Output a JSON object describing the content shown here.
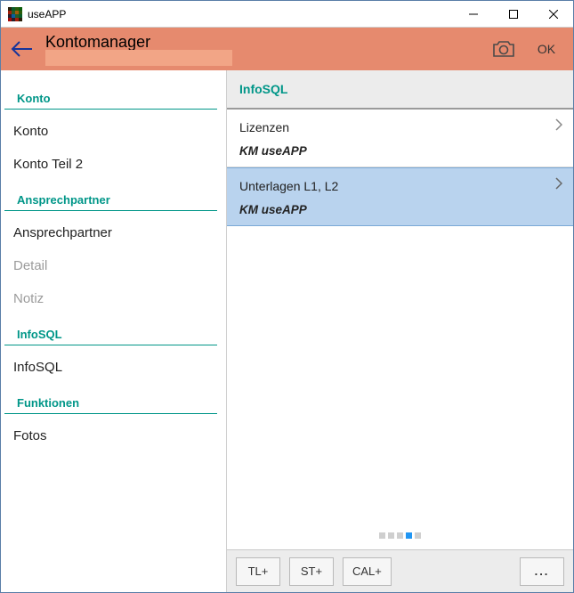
{
  "window": {
    "title": "useAPP"
  },
  "header": {
    "page_title": "Kontomanager",
    "ok_label": "OK"
  },
  "sidebar": {
    "sections": [
      {
        "header": "Konto",
        "items": [
          {
            "label": "Konto",
            "enabled": true
          },
          {
            "label": "Konto Teil 2",
            "enabled": true
          }
        ]
      },
      {
        "header": "Ansprechpartner",
        "items": [
          {
            "label": "Ansprechpartner",
            "enabled": true
          },
          {
            "label": "Detail",
            "enabled": false
          },
          {
            "label": "Notiz",
            "enabled": false
          }
        ]
      },
      {
        "header": "InfoSQL",
        "items": [
          {
            "label": "InfoSQL",
            "enabled": true
          }
        ]
      },
      {
        "header": "Funktionen",
        "items": [
          {
            "label": "Fotos",
            "enabled": true
          }
        ]
      }
    ]
  },
  "main": {
    "header": "InfoSQL",
    "items": [
      {
        "title": "Lizenzen",
        "subtitle": "KM useAPP",
        "selected": false
      },
      {
        "title": "Unterlagen L1, L2",
        "subtitle": "KM useAPP",
        "selected": true
      }
    ],
    "pager": {
      "count": 5,
      "active_index": 3
    }
  },
  "toolbar": {
    "buttons": [
      "TL+",
      "ST+",
      "CAL+"
    ],
    "more": "..."
  }
}
